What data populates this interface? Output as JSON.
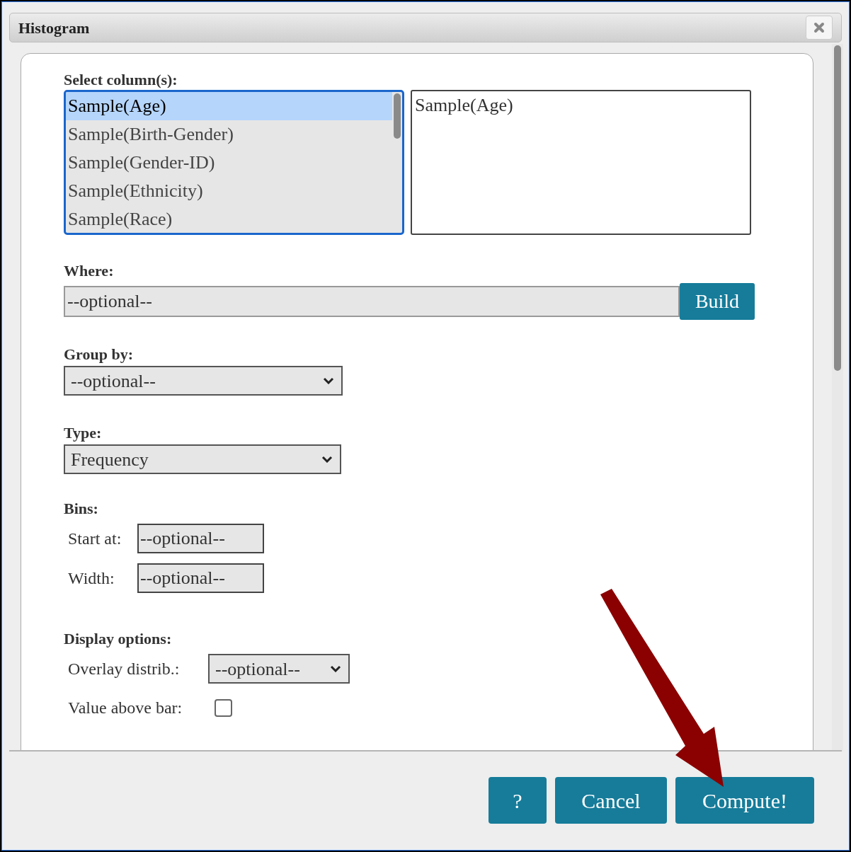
{
  "dialog": {
    "title": "Histogram"
  },
  "select_columns": {
    "label": "Select column(s):",
    "options": [
      {
        "label": "Sample(Age)",
        "selected": true
      },
      {
        "label": "Sample(Birth-Gender)",
        "selected": false
      },
      {
        "label": "Sample(Gender-ID)",
        "selected": false
      },
      {
        "label": "Sample(Ethnicity)",
        "selected": false
      },
      {
        "label": "Sample(Race)",
        "selected": false
      }
    ],
    "chosen": [
      "Sample(Age)"
    ]
  },
  "where": {
    "label": "Where:",
    "placeholder": "--optional--",
    "button": "Build"
  },
  "group_by": {
    "label": "Group by:",
    "value": "--optional--"
  },
  "type": {
    "label": "Type:",
    "value": "Frequency"
  },
  "bins": {
    "label": "Bins:",
    "fields": [
      {
        "label": "Start at:",
        "placeholder": "--optional--"
      },
      {
        "label": "Width:",
        "placeholder": "--optional--"
      }
    ]
  },
  "display_options": {
    "label": "Display options:",
    "overlay": {
      "label": "Overlay distrib.:",
      "value": "--optional--"
    },
    "value_above_bar": {
      "label": "Value above bar:",
      "checked": false
    }
  },
  "buttons": [
    "?",
    "Cancel",
    "Compute!"
  ]
}
